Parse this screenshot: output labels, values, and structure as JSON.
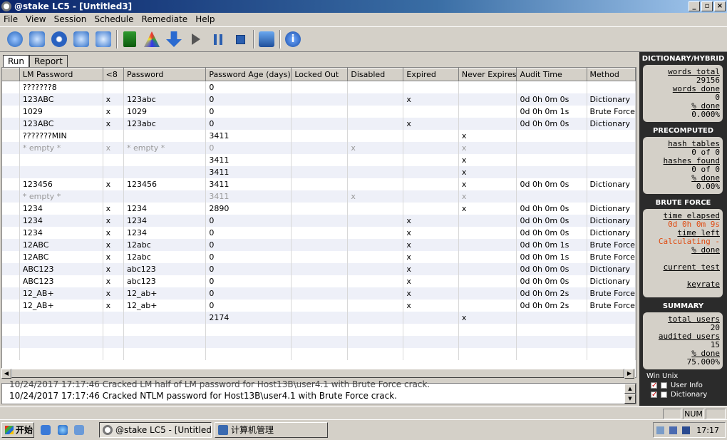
{
  "window": {
    "title": "@stake LC5 - [Untitled3]",
    "btn_min": "_",
    "btn_max": "▫",
    "btn_close": "×"
  },
  "menu": [
    "File",
    "View",
    "Session",
    "Schedule",
    "Remediate",
    "Help"
  ],
  "toolbar": {
    "icons": [
      "new-session-icon",
      "open-session-icon",
      "close-session-icon",
      "save-session-icon",
      "import-icon",
      "wizard-flag-icon",
      "options-icon",
      "download-icon",
      "start-icon",
      "pause-icon",
      "stop-icon",
      "schedule-icon",
      "about-icon"
    ]
  },
  "tabs": [
    "Run",
    "Report"
  ],
  "grid": {
    "columns": [
      "",
      "LM Password",
      "<8",
      "Password",
      "Password Age (days)",
      "Locked Out",
      "Disabled",
      "Expired",
      "Never Expires",
      "Audit Time",
      "Method"
    ],
    "rows": [
      [
        "",
        "???????8",
        "",
        "",
        "0",
        "",
        "",
        "",
        "",
        "",
        ""
      ],
      [
        "",
        "123ABC",
        "x",
        "123abc",
        "0",
        "",
        "",
        "x",
        "",
        "0d 0h 0m 0s",
        "Dictionary"
      ],
      [
        "",
        "1029",
        "x",
        "1029",
        "0",
        "",
        "",
        "",
        "",
        "0d 0h 0m 1s",
        "Brute Force"
      ],
      [
        "",
        "123ABC",
        "x",
        "123abc",
        "0",
        "",
        "",
        "x",
        "",
        "0d 0h 0m 0s",
        "Dictionary"
      ],
      [
        "",
        "???????MIN",
        "",
        "",
        "3411",
        "",
        "",
        "",
        "x",
        "",
        ""
      ],
      [
        "",
        "* empty *",
        "x",
        "* empty *",
        "0",
        "",
        "x",
        "",
        "x",
        "",
        ""
      ],
      [
        "",
        "",
        "",
        "",
        "3411",
        "",
        "",
        "",
        "x",
        "",
        ""
      ],
      [
        "",
        "",
        "",
        "",
        "3411",
        "",
        "",
        "",
        "x",
        "",
        ""
      ],
      [
        "",
        "123456",
        "x",
        "123456",
        "3411",
        "",
        "",
        "",
        "x",
        "0d 0h 0m 0s",
        "Dictionary"
      ],
      [
        "",
        "* empty *",
        "",
        "",
        "3411",
        "",
        "x",
        "",
        "x",
        "",
        ""
      ],
      [
        "",
        "1234",
        "x",
        "1234",
        "2890",
        "",
        "",
        "",
        "x",
        "0d 0h 0m 0s",
        "Dictionary"
      ],
      [
        "",
        "1234",
        "x",
        "1234",
        "0",
        "",
        "",
        "x",
        "",
        "0d 0h 0m 0s",
        "Dictionary"
      ],
      [
        "",
        "1234",
        "x",
        "1234",
        "0",
        "",
        "",
        "x",
        "",
        "0d 0h 0m 0s",
        "Dictionary"
      ],
      [
        "",
        "12ABC",
        "x",
        "12abc",
        "0",
        "",
        "",
        "x",
        "",
        "0d 0h 0m 1s",
        "Brute Force"
      ],
      [
        "",
        "12ABC",
        "x",
        "12abc",
        "0",
        "",
        "",
        "x",
        "",
        "0d 0h 0m 1s",
        "Brute Force"
      ],
      [
        "",
        "ABC123",
        "x",
        "abc123",
        "0",
        "",
        "",
        "x",
        "",
        "0d 0h 0m 0s",
        "Dictionary"
      ],
      [
        "",
        "ABC123",
        "x",
        "abc123",
        "0",
        "",
        "",
        "x",
        "",
        "0d 0h 0m 0s",
        "Dictionary"
      ],
      [
        "",
        "12_AB+",
        "x",
        "12_ab+",
        "0",
        "",
        "",
        "x",
        "",
        "0d 0h 0m 2s",
        "Brute Force"
      ],
      [
        "",
        "12_AB+",
        "x",
        "12_ab+",
        "0",
        "",
        "",
        "x",
        "",
        "0d 0h 0m 2s",
        "Brute Force"
      ],
      [
        "",
        "",
        "",
        "",
        "2174",
        "",
        "",
        "",
        "x",
        "",
        ""
      ],
      [
        "",
        "",
        "",
        "",
        "",
        "",
        "",
        "",
        "",
        "",
        ""
      ],
      [
        "",
        "",
        "",
        "",
        "",
        "",
        "",
        "",
        "",
        "",
        ""
      ],
      [
        "",
        "",
        "",
        "",
        "",
        "",
        "",
        "",
        "",
        "",
        ""
      ]
    ],
    "dim_rows": [
      5,
      9
    ]
  },
  "log": {
    "line1": "10/24/2017 17:17:46 Cracked LM half of LM password for Host13B\\user4.1 with Brute Force crack.",
    "line2": "10/24/2017 17:17:46 Cracked NTLM password for Host13B\\user4.1 with Brute Force crack."
  },
  "dictionary": {
    "header": "DICTIONARY/HYBRID",
    "words_total_label": "words total",
    "words_total": "29156",
    "words_done_label": "words done",
    "words_done": "0",
    "pct_label": "% done",
    "pct": "0.000%"
  },
  "precomputed": {
    "header": "PRECOMPUTED",
    "hash_tables_label": "hash tables",
    "hash_tables": "0 of 0",
    "hashes_found_label": "hashes found",
    "hashes_found": "0 of 0",
    "pct_label": "% done",
    "pct": "0.00%"
  },
  "brute": {
    "header": "BRUTE FORCE",
    "elapsed_label": "time elapsed",
    "elapsed": "0d 0h 0m 9s",
    "left_label": "time left",
    "left": "Calculating -",
    "pct_label": "% done",
    "pct": "",
    "current_label": "current test",
    "current": "",
    "keyrate_label": "keyrate",
    "keyrate": ""
  },
  "summary": {
    "header": "SUMMARY",
    "total_label": "total users",
    "total": "20",
    "audited_label": "audited users",
    "audited": "15",
    "pct_label": "% done",
    "pct": "75.000%"
  },
  "options": {
    "header": "Win Unix",
    "items": [
      "User Info",
      "Dictionary"
    ]
  },
  "status": {
    "num": "NUM"
  },
  "taskbar": {
    "start": "开始",
    "tasks": [
      "@stake LC5 - [Untitled3]",
      "计算机管理"
    ],
    "clock": "17:17"
  },
  "colors": {
    "title_start": "#0a246a",
    "title_end": "#a6caf0",
    "stats_bg": "#2b2b2b",
    "brute_highlight": "#e04a10"
  }
}
